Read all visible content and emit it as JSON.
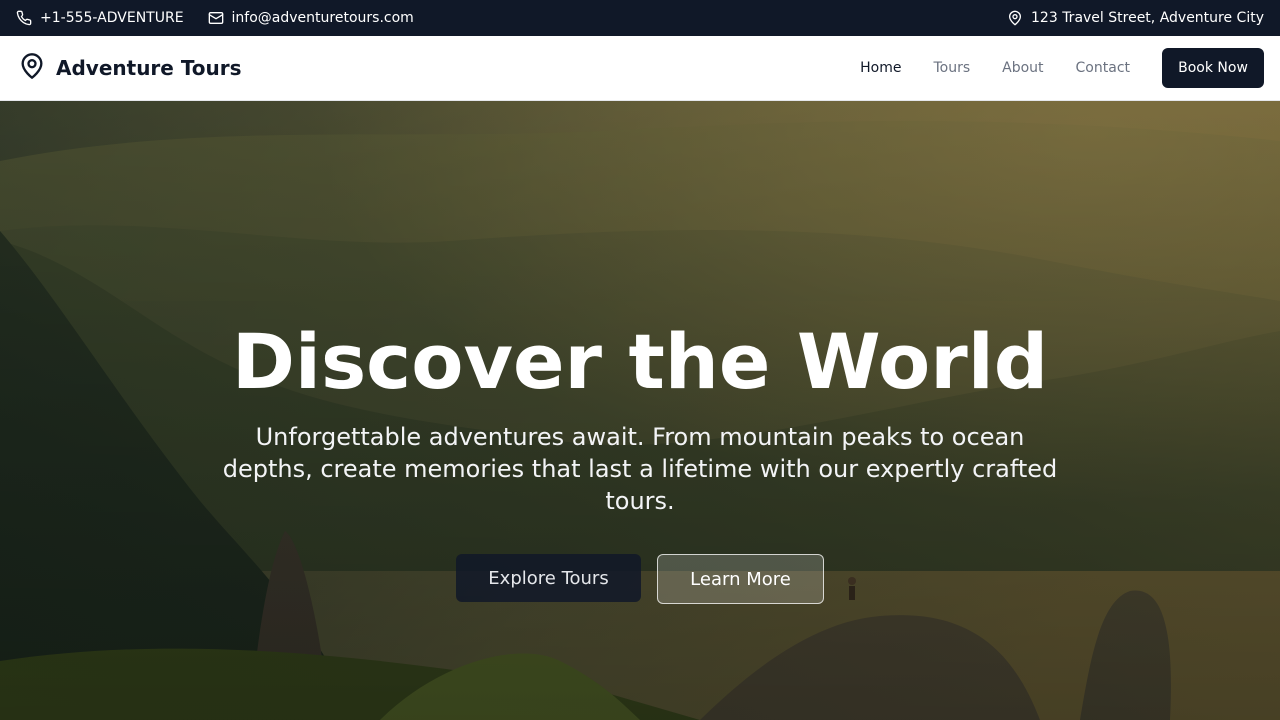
{
  "topbar": {
    "phone": "+1-555-ADVENTURE",
    "email": "info@adventuretours.com",
    "address": "123 Travel Street, Adventure City",
    "icons": [
      "phone-icon",
      "mail-icon",
      "map-pin-icon"
    ]
  },
  "navbar": {
    "brand": "Adventure Tours",
    "brand_icon": "map-pin-icon",
    "links": [
      {
        "label": "Home",
        "active": true
      },
      {
        "label": "Tours",
        "active": false
      },
      {
        "label": "About",
        "active": false
      },
      {
        "label": "Contact",
        "active": false
      }
    ],
    "cta": "Book Now"
  },
  "hero": {
    "title": "Discover the World",
    "subtitle": "Unforgettable adventures await. From mountain peaks to ocean depths, create memories that last a lifetime with our expertly crafted tours.",
    "primary_button": "Explore Tours",
    "secondary_button": "Learn More"
  },
  "colors": {
    "dark": "#101828",
    "muted_link": "#6b7280",
    "white": "#ffffff"
  }
}
